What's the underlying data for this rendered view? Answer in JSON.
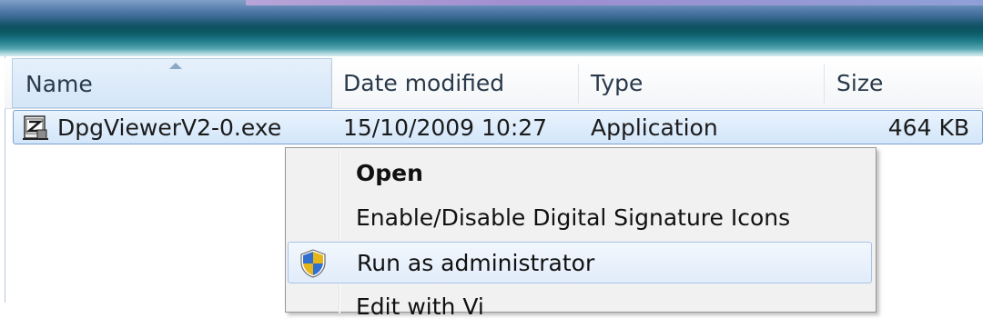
{
  "columns": {
    "name": "Name",
    "date_modified": "Date modified",
    "type": "Type",
    "size": "Size"
  },
  "file": {
    "name": "DpgViewerV2-0.exe",
    "date_modified": "15/10/2009 10:27",
    "type": "Application",
    "size": "464 KB",
    "icon": "application-exe-icon"
  },
  "context_menu": {
    "items": [
      {
        "label": "Open",
        "default": true
      },
      {
        "label": "Enable/Disable Digital Signature Icons"
      },
      {
        "label": "Run as administrator",
        "icon": "uac-shield-icon",
        "highlighted": true
      },
      {
        "label": "Edit with Vi"
      }
    ]
  },
  "colors": {
    "selection_border": "#7da2ce",
    "selection_fill": "#d3e6fa",
    "menu_background": "#f1f1f1"
  }
}
